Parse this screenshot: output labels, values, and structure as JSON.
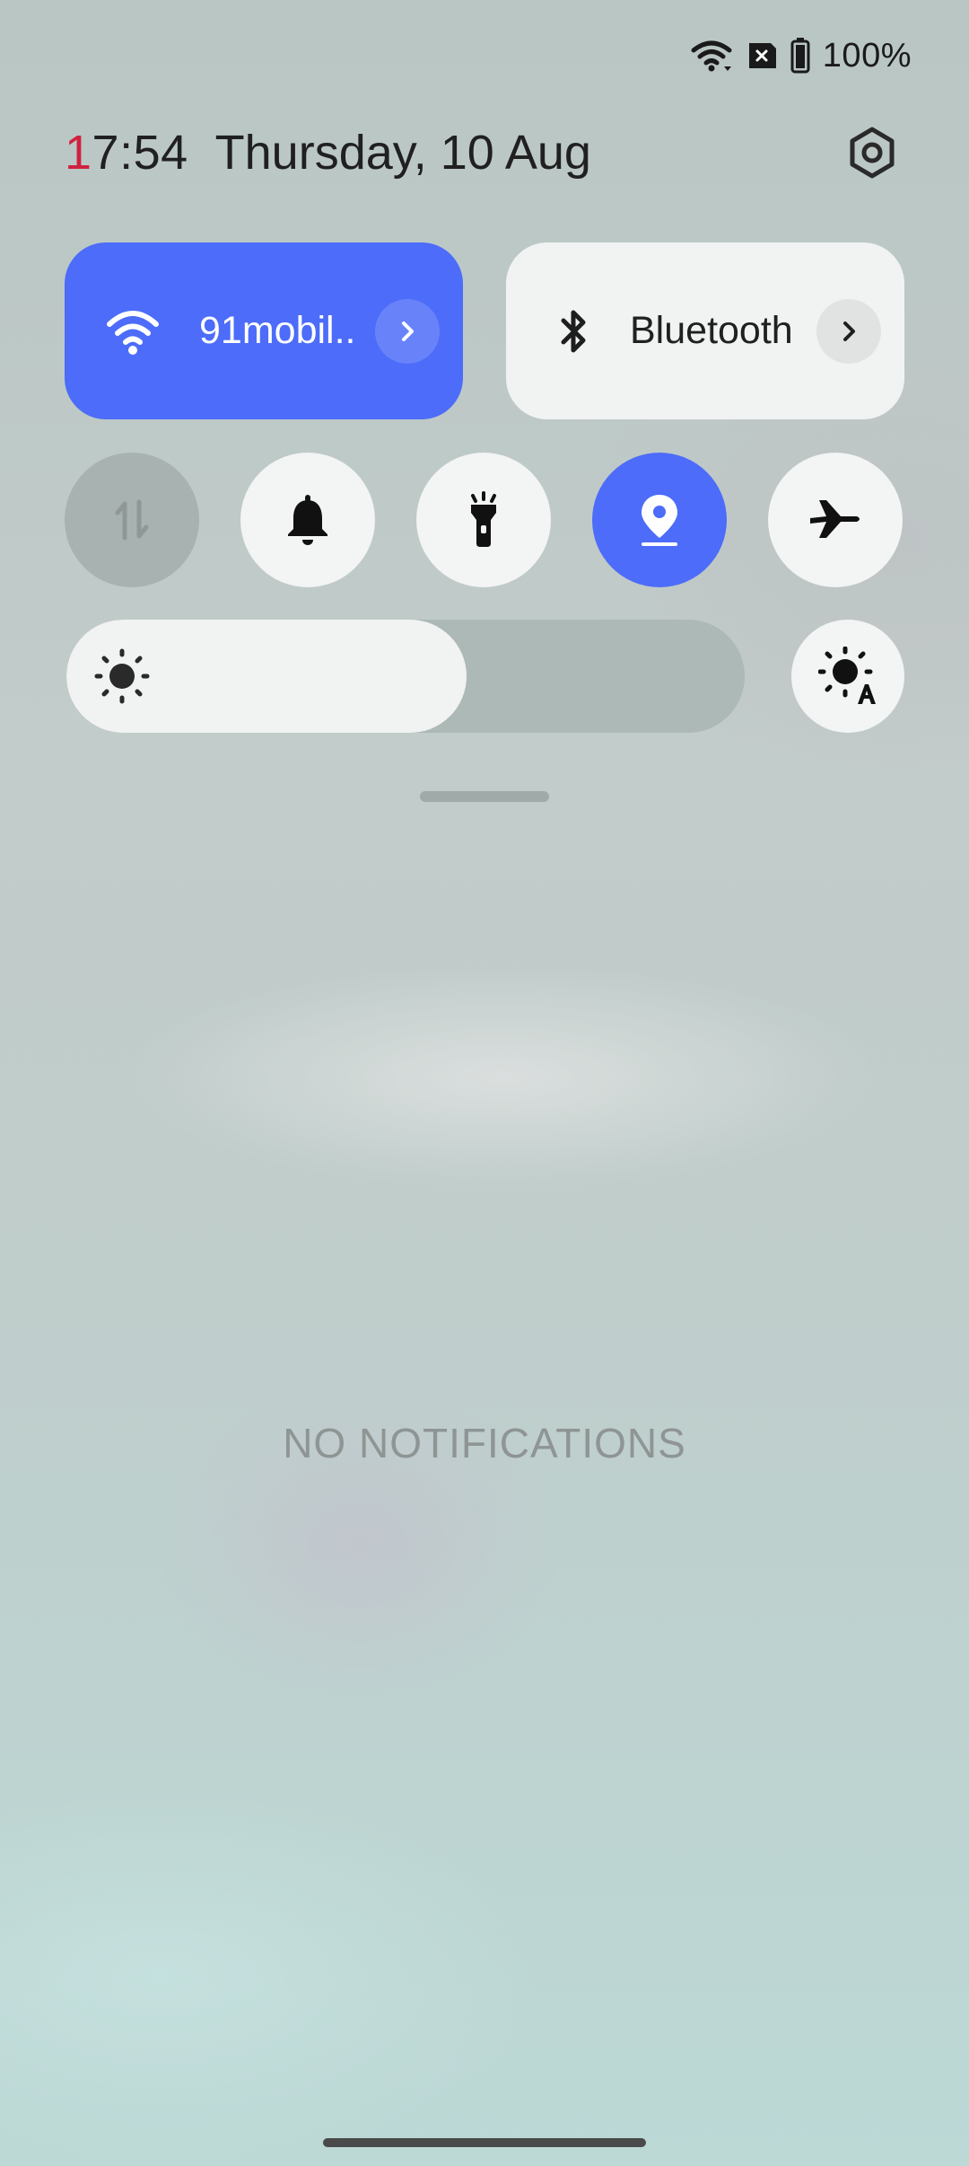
{
  "status_bar": {
    "battery_text": "100%",
    "icons": [
      "wifi-icon",
      "no-sim-icon",
      "battery-icon"
    ]
  },
  "header": {
    "clock_first_digit": "1",
    "clock_rest": "7:54",
    "date": "Thursday, 10 Aug",
    "settings_icon": "gear-icon"
  },
  "tiles": {
    "wifi": {
      "label": "91mobil..",
      "icon": "wifi-icon",
      "active": true
    },
    "bluetooth": {
      "label": "Bluetooth",
      "icon": "bluetooth-icon",
      "active": false
    }
  },
  "toggles": [
    {
      "name": "mobile-data",
      "icon": "mobile-data-icon",
      "state": "disabled"
    },
    {
      "name": "ring",
      "icon": "bell-icon",
      "state": "off"
    },
    {
      "name": "flashlight",
      "icon": "flashlight-icon",
      "state": "off"
    },
    {
      "name": "location",
      "icon": "location-icon",
      "state": "on"
    },
    {
      "name": "airplane-mode",
      "icon": "airplane-icon",
      "state": "off"
    }
  ],
  "brightness": {
    "level": 0.59,
    "icon": "sun-icon",
    "auto_icon": "auto-brightness-icon"
  },
  "notifications": {
    "empty_text": "NO NOTIFICATIONS"
  },
  "colors": {
    "accent": "#4c6cf9",
    "clock_accent": "#d0223e",
    "tile_inactive": "#f1f3f3"
  }
}
